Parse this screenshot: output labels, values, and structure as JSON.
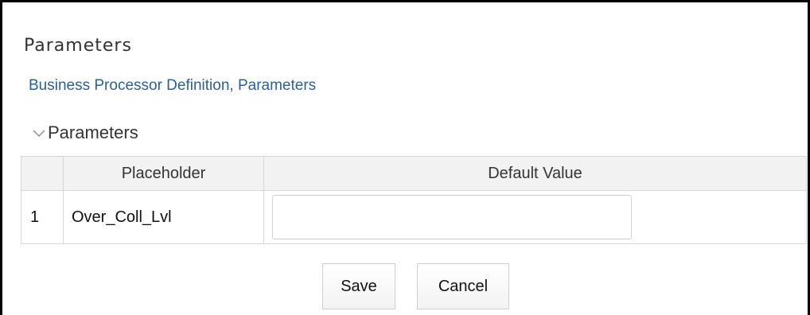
{
  "page": {
    "title": "Parameters",
    "breadcrumb": "Business Processor Definition, Parameters"
  },
  "section": {
    "label": "Parameters",
    "expanded": true,
    "icon": "chevron-down-icon"
  },
  "table": {
    "columns": [
      "",
      "Placeholder",
      "Default Value"
    ],
    "rows": [
      {
        "index": "1",
        "placeholder": "Over_Coll_Lvl",
        "default_value": ""
      }
    ]
  },
  "buttons": {
    "save": "Save",
    "cancel": "Cancel"
  },
  "colors": {
    "link": "#2a6099",
    "header_bg": "#f2f2f2",
    "border": "#d6d6d6"
  }
}
